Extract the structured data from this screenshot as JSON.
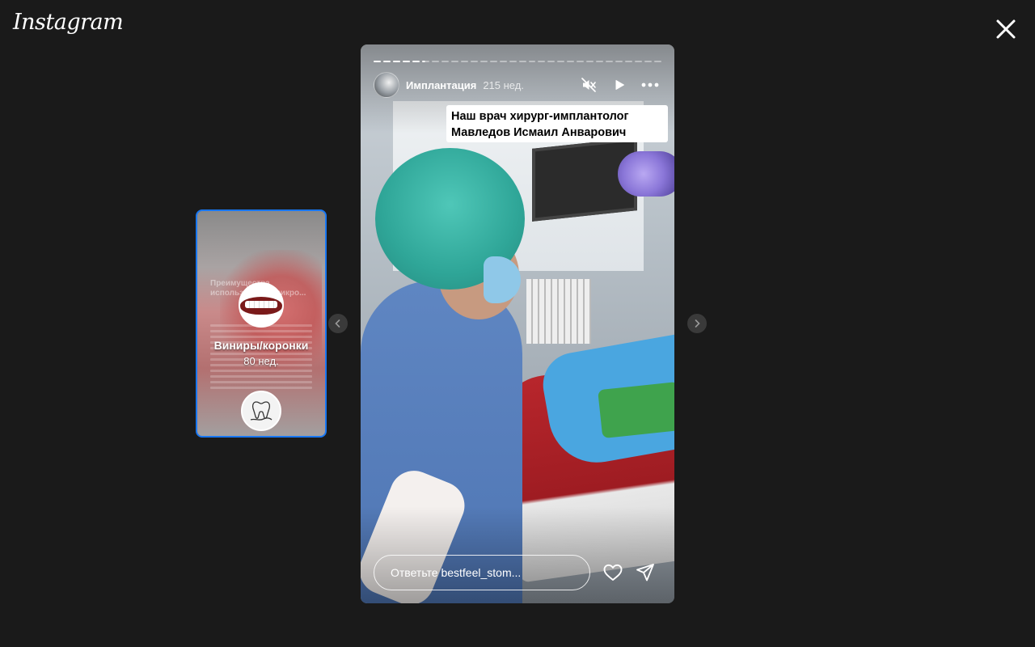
{
  "app": {
    "logo_text": "Instagram"
  },
  "preview_story": {
    "faded_heading": "Преимущества использования микро...",
    "title": "Виниры/коронки",
    "time": "80 нед."
  },
  "main_story": {
    "account_name": "Имплантация",
    "time": "215 нед.",
    "caption": "Наш врач хирург-имплантолог Мавледов Исмаил Анварович",
    "reply_placeholder": "Ответьте bestfeel_stom...",
    "progress": {
      "segments": 30,
      "completed": 5
    }
  },
  "icons": {
    "close": "close-icon",
    "mute": "speaker-muted-icon",
    "play": "play-icon",
    "more": "more-horizontal-icon",
    "heart": "heart-icon",
    "share": "paper-plane-icon",
    "prev": "chevron-left-icon",
    "next": "chevron-right-icon"
  },
  "colors": {
    "background": "#1a1a1a",
    "preview_border": "#1877f2"
  }
}
